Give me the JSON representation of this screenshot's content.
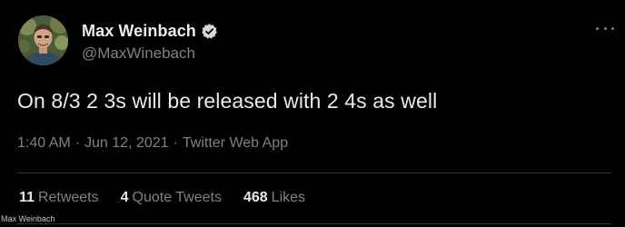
{
  "author": {
    "display_name": "Max Weinbach",
    "handle": "@MaxWinebach",
    "verified": true
  },
  "tweet": {
    "text": "On 8/3 2 3s will be released with 2 4s as well",
    "time": "1:40 AM",
    "date": "Jun 12, 2021",
    "source": "Twitter Web App",
    "separator": "·"
  },
  "stats": [
    {
      "count": "11",
      "label": "Retweets"
    },
    {
      "count": "4",
      "label": "Quote Tweets"
    },
    {
      "count": "468",
      "label": "Likes"
    }
  ],
  "watermark": "Max Weinbach",
  "icons": {
    "verified": "verified-badge-icon",
    "more": "more-options-icon"
  },
  "colors": {
    "background": "#000000",
    "primary_text": "#e7e9ea",
    "secondary_text": "#7d8287",
    "divider": "#2f3336"
  }
}
